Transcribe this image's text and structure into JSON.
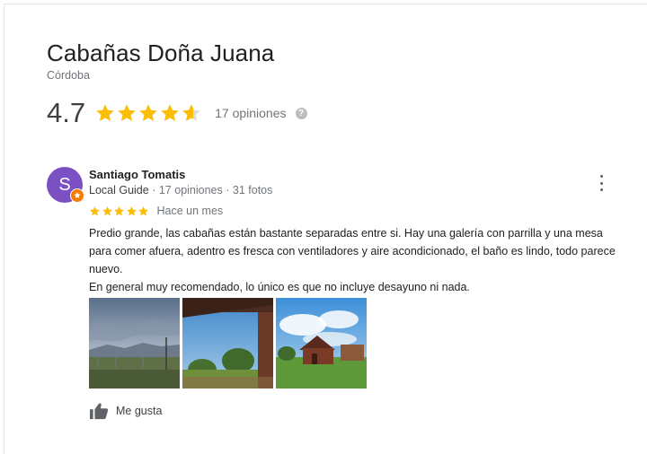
{
  "business": {
    "name": "Cabañas Doña Juana",
    "location": "Córdoba",
    "rating": "4.7",
    "rating_fraction": 0.94,
    "review_count": "17 opiniones"
  },
  "review": {
    "avatar_letter": "S",
    "reviewer_name": "Santiago Tomatis",
    "guide_label": "Local Guide",
    "separator": "·",
    "reviews_count": "17 opiniones",
    "photos_count": "31 fotos",
    "stars": 5,
    "time": "Hace un mes",
    "text_lines": [
      "Predio grande, las cabañas están bastante separadas entre si. Hay una galería con parrilla y una mesa para comer afuera, adentro es fresca con ventiladores y aire acondicionado, el baño es lindo, todo parece nuevo.",
      "En general muy recomendado, lo único es que no incluye desayuno ni nada."
    ],
    "like_label": "Me gusta"
  },
  "colors": {
    "star": "#fbbc04",
    "star_empty": "#dadce0",
    "avatar": "#7a50c3",
    "badge": "#f57c00"
  },
  "icons": [
    "star-icon",
    "help-icon",
    "more-vert-icon",
    "local-guide-badge-icon",
    "thumbs-up-icon"
  ]
}
